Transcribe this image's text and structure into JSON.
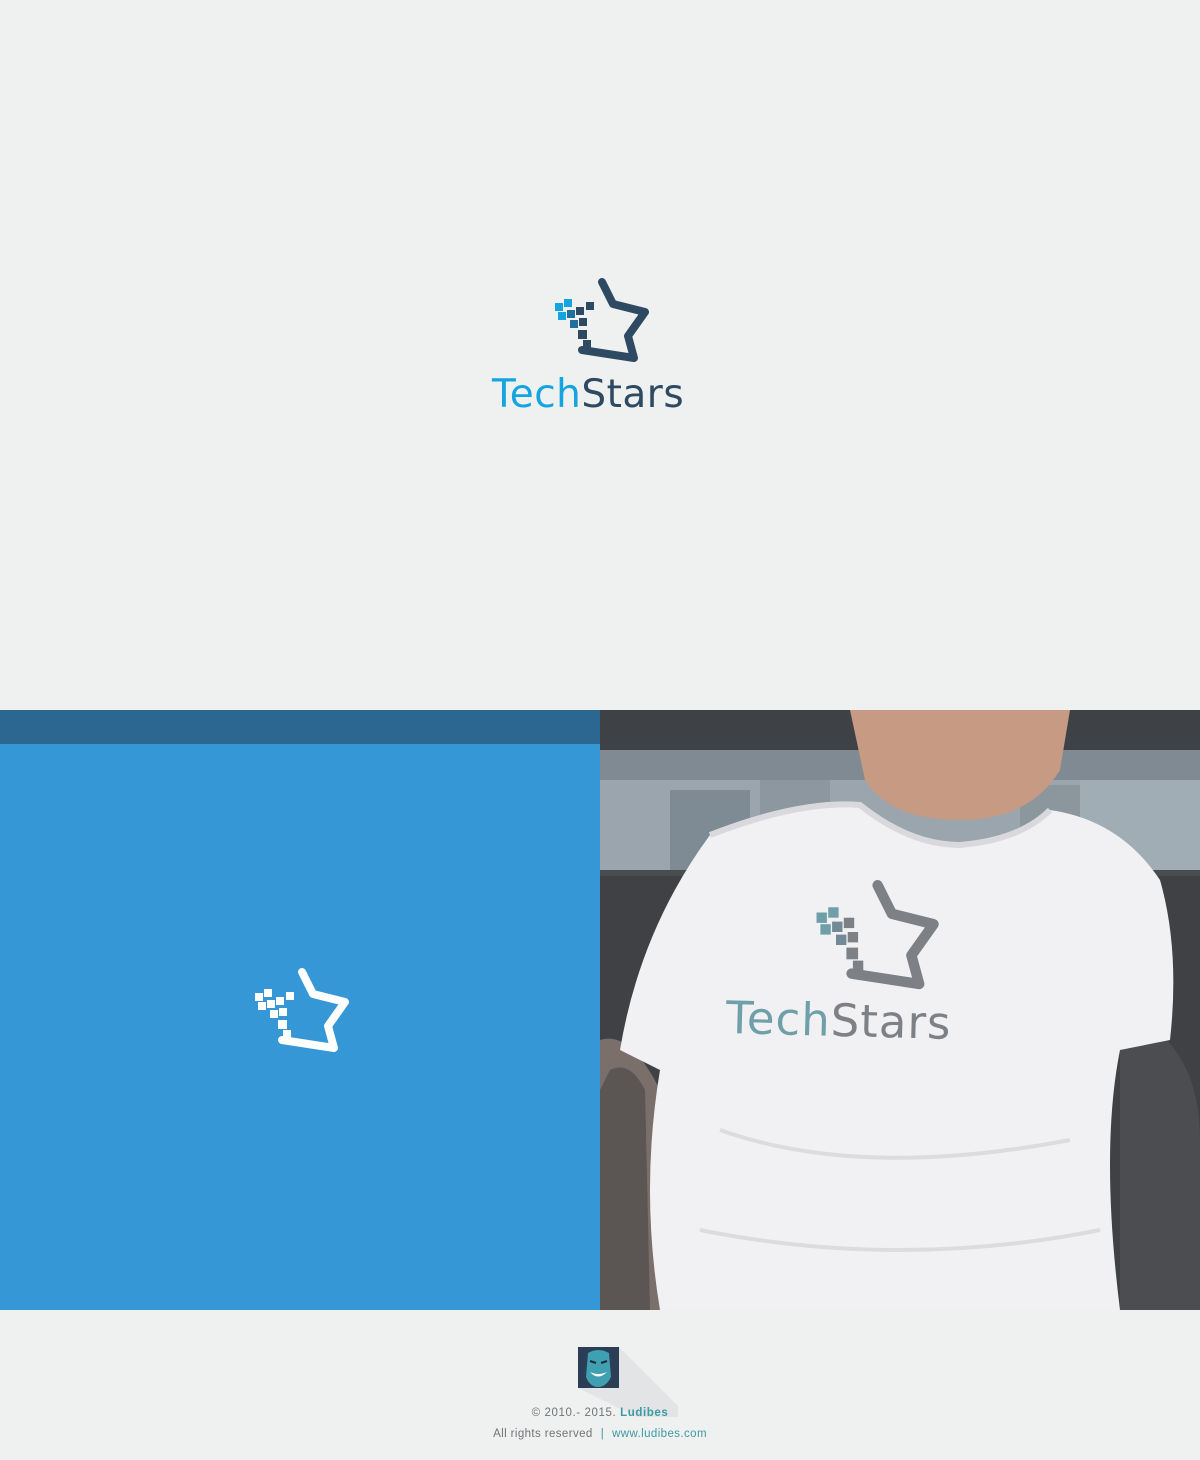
{
  "hero": {
    "brand_part1": "Tech",
    "brand_part2": "Stars",
    "logo_icon": "pixel-star-icon"
  },
  "blue_panel": {
    "logo_icon": "pixel-star-icon"
  },
  "photo_panel": {
    "shirt_brand_part1": "Tech",
    "shirt_brand_part2": "Stars"
  },
  "footer": {
    "avatar_icon": "grinning-face-icon",
    "copyright_prefix": "©  2010.- 2015.",
    "copyright_brand": "Ludibes",
    "rights_text": "All rights reserved",
    "separator": "|",
    "website": "www.ludibes.com"
  },
  "colors": {
    "background": "#eff0f0",
    "tech_blue": "#14a5e1",
    "stars_navy": "#2e4a63",
    "panel_blue": "#3597d5",
    "panel_band": "#2c6791",
    "footer_accent": "#3d9aa6"
  }
}
